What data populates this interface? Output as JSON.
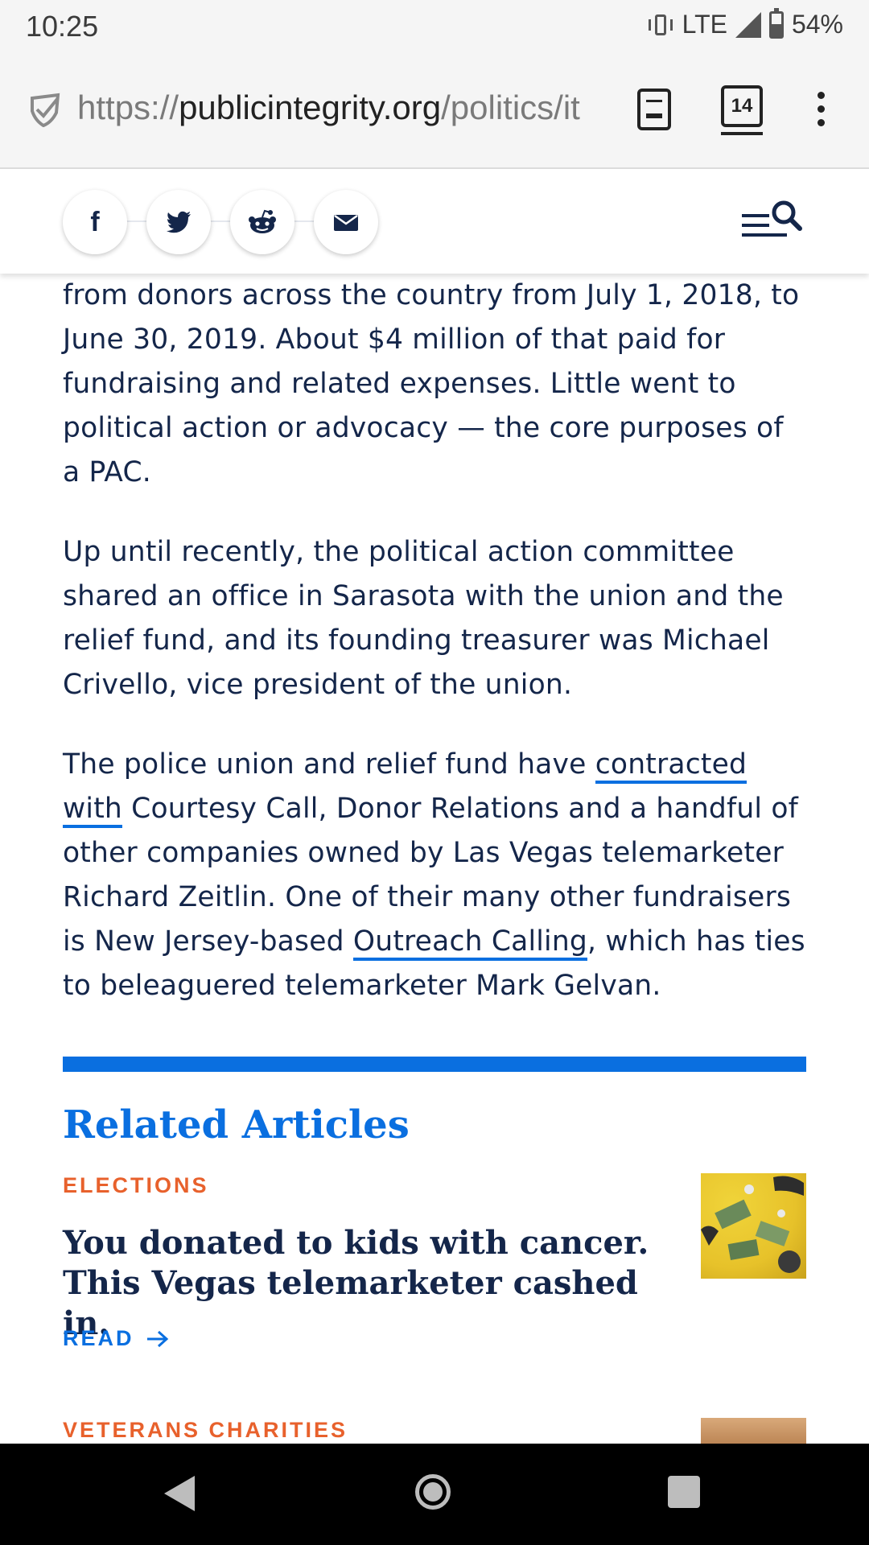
{
  "status_bar": {
    "time": "10:25",
    "network": "LTE",
    "battery": "54%",
    "battery_level": 0.54
  },
  "browser": {
    "url_scheme": "https://",
    "url_host": "publicintegrity.org",
    "url_path": "/politics/it",
    "tab_count": "14"
  },
  "share": {
    "icons": [
      "facebook-icon",
      "twitter-icon",
      "reddit-icon",
      "email-icon"
    ],
    "facebook_glyph": "f"
  },
  "article": {
    "p1": "from donors across the country from July 1, 2018, to June 30, 2019. About $4 million of that paid for fundraising and related expenses. Little went to political action or advocacy — the core purposes of a PAC.",
    "p2": "Up until recently, the political action committee shared an office in Sarasota with the union and the relief fund, and its founding treasurer was Michael Crivello, vice president of the union.",
    "p3_a": "The police union and relief fund have ",
    "p3_link1": "contracted with",
    "p3_b": " Courtesy Call, Donor Relations and a handful of other companies owned by Las Vegas telemarketer Richard Zeitlin. One of their many other fundraisers is New Jersey-based ",
    "p3_link2": "Outreach Calling",
    "p3_c": ", which has ties to beleaguered telemarketer Mark Gelvan."
  },
  "related": {
    "title": "Related Articles",
    "items": [
      {
        "category": "ELECTIONS",
        "title": "You donated to kids with cancer. This Vegas telemarketer cashed in.",
        "read": "READ"
      },
      {
        "category": "VETERANS CHARITIES"
      }
    ]
  },
  "colors": {
    "accent": "#0a6fe0",
    "category": "#e8612c",
    "text": "#14264a"
  }
}
